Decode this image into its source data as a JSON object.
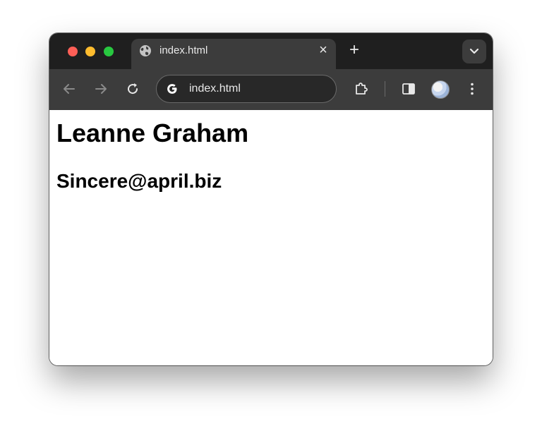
{
  "browser": {
    "tab": {
      "title": "index.html",
      "close_glyph": "×"
    },
    "new_tab_glyph": "+",
    "address_bar": {
      "text": "index.html"
    },
    "icons": {
      "tab_favicon": "globe-icon",
      "back": "arrow-left-icon",
      "forward": "arrow-right-icon",
      "reload": "reload-icon",
      "omnibox": "google-g-icon",
      "extensions": "puzzle-icon",
      "side_panel": "side-panel-icon",
      "menu": "kebab-menu-icon",
      "tab_search": "chevron-down-icon"
    }
  },
  "page": {
    "name": "Leanne Graham",
    "email": "Sincere@april.biz"
  }
}
